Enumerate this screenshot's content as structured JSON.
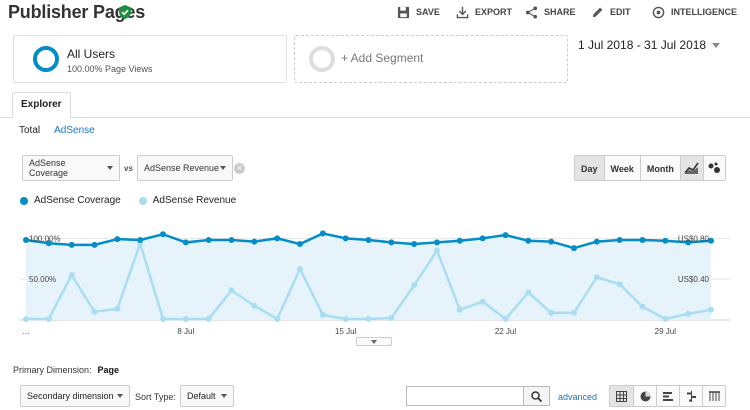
{
  "header": {
    "title": "Publisher Pages",
    "actions": [
      {
        "label": "SAVE",
        "icon": "save-icon"
      },
      {
        "label": "EXPORT",
        "icon": "export-icon"
      },
      {
        "label": "SHARE",
        "icon": "share-icon"
      },
      {
        "label": "EDIT",
        "icon": "edit-icon"
      },
      {
        "label": "INTELLIGENCE",
        "icon": "intelligence-icon"
      }
    ]
  },
  "segments": {
    "primary": {
      "name": "All Users",
      "sub": "100.00% Page Views",
      "color": "#058dc7"
    },
    "add_label": "+ Add Segment"
  },
  "date_range": "1 Jul 2018 - 31 Jul 2018",
  "tabs": {
    "explorer": "Explorer"
  },
  "subtabs": {
    "total": "Total",
    "adsense": "AdSense"
  },
  "metric_select": {
    "metric1": "AdSense Coverage",
    "vs": "vs",
    "metric2": "AdSense Revenue"
  },
  "granularity": {
    "day": "Day",
    "week": "Week",
    "month": "Month",
    "selected": "Day"
  },
  "legend": {
    "series1": "AdSense Coverage",
    "series2": "AdSense Revenue"
  },
  "colors": {
    "series1": "#058dc7",
    "series2": "#a9ddf1",
    "area": "#e6f3fa"
  },
  "chart_data": {
    "type": "line",
    "x_labels": [
      "...",
      "8 Jul",
      "15 Jul",
      "22 Jul",
      "29 Jul"
    ],
    "x": [
      "1 Jul",
      "2 Jul",
      "3 Jul",
      "4 Jul",
      "5 Jul",
      "6 Jul",
      "7 Jul",
      "8 Jul",
      "9 Jul",
      "10 Jul",
      "11 Jul",
      "12 Jul",
      "13 Jul",
      "14 Jul",
      "15 Jul",
      "16 Jul",
      "17 Jul",
      "18 Jul",
      "19 Jul",
      "20 Jul",
      "21 Jul",
      "22 Jul",
      "23 Jul",
      "24 Jul",
      "25 Jul",
      "26 Jul",
      "27 Jul",
      "28 Jul",
      "29 Jul",
      "30 Jul",
      "31 Jul"
    ],
    "y_left_ticks": [
      "100.00%",
      "50.00%"
    ],
    "y_right_ticks": [
      "US$0.80",
      "US$0.40"
    ],
    "series": [
      {
        "name": "AdSense Coverage",
        "axis": "left",
        "values": [
          98,
          94,
          92,
          92,
          99,
          98,
          105,
          95,
          98,
          98,
          96,
          100,
          93,
          106,
          100,
          98,
          95,
          93,
          95,
          97,
          100,
          104,
          97,
          96,
          88,
          96,
          98,
          98,
          97,
          95,
          97
        ]
      },
      {
        "name": "AdSense Revenue",
        "axis": "right",
        "values": [
          0.01,
          0.01,
          0.44,
          0.08,
          0.11,
          0.75,
          0.01,
          0.01,
          0.01,
          0.29,
          0.14,
          0.01,
          0.5,
          0.05,
          0.01,
          0.01,
          0.02,
          0.34,
          0.68,
          0.1,
          0.18,
          0.01,
          0.27,
          0.07,
          0.07,
          0.42,
          0.35,
          0.13,
          0.01,
          0.06,
          0.1
        ]
      }
    ],
    "ylim_left": [
      0,
      120
    ],
    "ylim_right": [
      0,
      0.96
    ],
    "grid": true
  },
  "primary_dimension": {
    "label": "Primary Dimension:",
    "value": "Page"
  },
  "bottom": {
    "secondary_dimension": "Secondary dimension",
    "sort_type_label": "Sort Type:",
    "sort_type_value": "Default",
    "search_value": "",
    "advanced": "advanced"
  }
}
